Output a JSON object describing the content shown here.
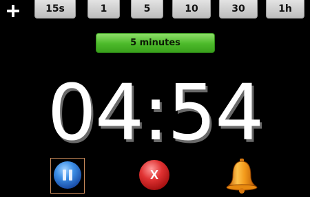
{
  "toolbar": {
    "add_icon": "plus-icon",
    "presets": [
      "15s",
      "1",
      "5",
      "10",
      "30",
      "1h"
    ]
  },
  "status": {
    "label": "5 minutes",
    "color": "#4cba2a"
  },
  "timer": {
    "display": "04:54"
  },
  "controls": {
    "pause_icon": "pause-icon",
    "cancel_icon": "cancel-icon",
    "cancel_glyph": "X",
    "bell_icon": "bell-icon"
  },
  "colors": {
    "background": "#000000",
    "pause": "#3d8fe6",
    "cancel": "#e03232",
    "bell": "#f39a1b"
  }
}
